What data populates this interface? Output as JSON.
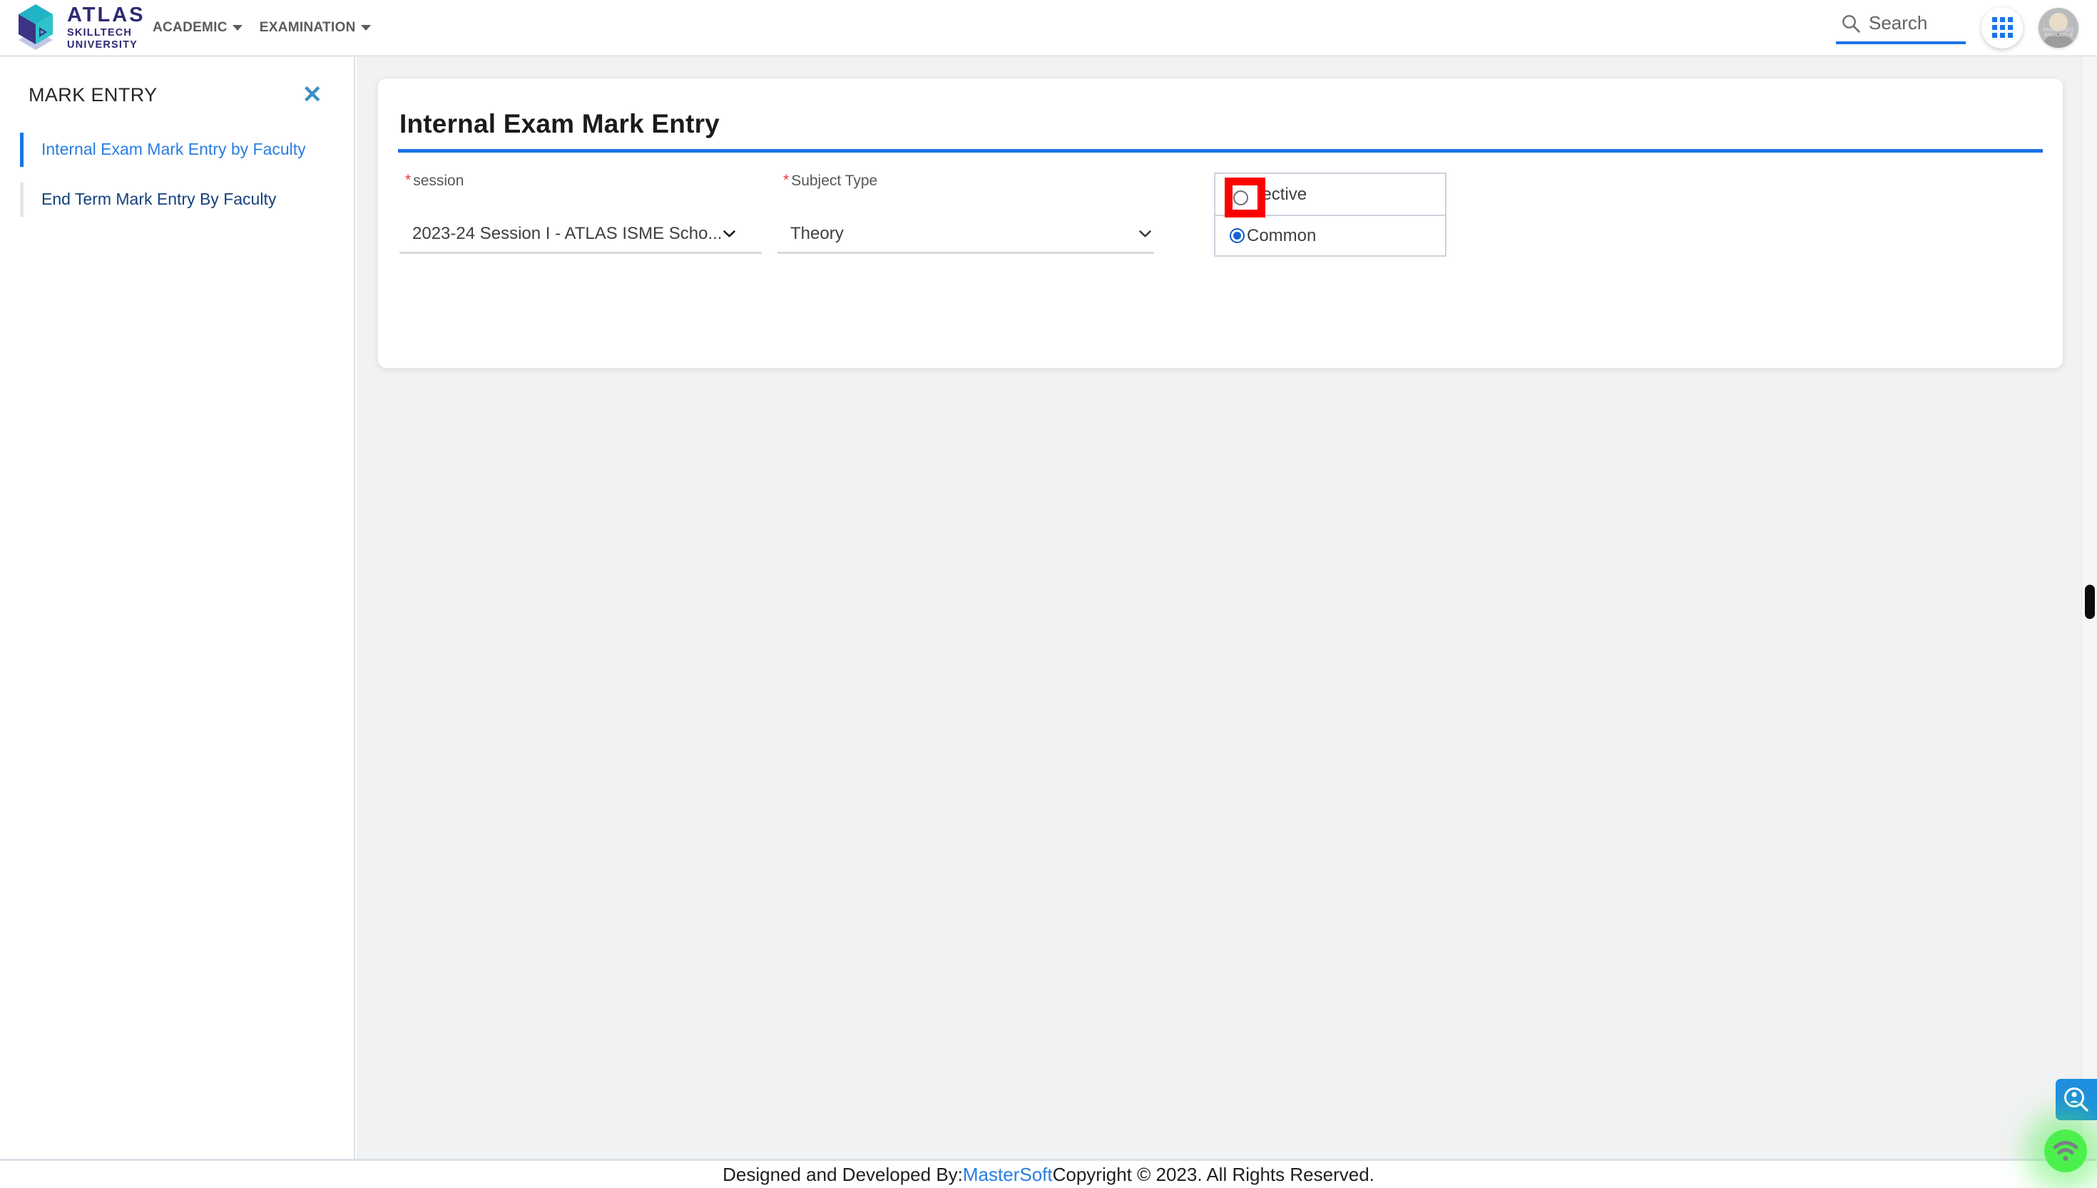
{
  "header": {
    "brand": {
      "name_main": "ATLAS",
      "name_line2": "SKILLTECH",
      "name_line3": "UNIVERSITY",
      "cube_icon": "atlas-cube-logo",
      "colors": {
        "cube_top": "#22b3c4",
        "cube_left": "#3b3484",
        "cube_right": "#2ec4c9",
        "cube_shadow": "#c3c6e6",
        "text": "#2e2a72"
      }
    },
    "nav": [
      {
        "label": "ACADEMIC",
        "icon": "chevron-down-icon"
      },
      {
        "label": "EXAMINATION",
        "icon": "chevron-down-icon"
      }
    ],
    "search": {
      "placeholder": "Search",
      "value": "",
      "icon": "search-icon",
      "underline_color": "#1a73e8"
    },
    "apps_button": {
      "icon": "apps-grid-icon",
      "color": "#1a73e8"
    },
    "avatar": {
      "icon": "avatar-photo-not-available",
      "text": "PHOTO NOT AVAILABLE"
    }
  },
  "sidebar": {
    "title": "MARK ENTRY",
    "close_icon": "close-x-icon",
    "items": [
      {
        "label": "Internal Exam Mark Entry by Faculty",
        "active": true
      },
      {
        "label": "End Term Mark Entry By Faculty",
        "active": false
      }
    ],
    "active_color": "#2a7de1",
    "inactive_color": "#16417c"
  },
  "main": {
    "card": {
      "title": "Internal Exam Mark Entry",
      "rule_color": "#1a73e8",
      "fields": [
        {
          "label": "session",
          "required": true,
          "type": "select",
          "value": "2023-24 Session I - ATLAS ISME Scho...",
          "icon": "chevron-down-icon"
        },
        {
          "label": "Subject Type",
          "required": true,
          "type": "select",
          "value": "Theory",
          "icon": "chevron-down-icon"
        }
      ],
      "radio_group": {
        "name": "subject-category",
        "options": [
          {
            "label": "Elective",
            "selected": false,
            "highlighted": true
          },
          {
            "label": "Common",
            "selected": true,
            "highlighted": false
          }
        ],
        "highlight_color": "#fa0000",
        "selected_color": "#1565d8"
      }
    }
  },
  "footer": {
    "prefix": "Designed and Developed By: ",
    "link": "MasterSoft",
    "suffix": " Copyright © 2023. All Rights Reserved.",
    "link_color": "#2a7de1"
  },
  "floating": {
    "search_widget": {
      "icon": "person-search-icon",
      "color": "#1f8fdf"
    },
    "wifi_widget": {
      "icon": "wifi-signal-icon",
      "color": "#4cf04c"
    }
  }
}
